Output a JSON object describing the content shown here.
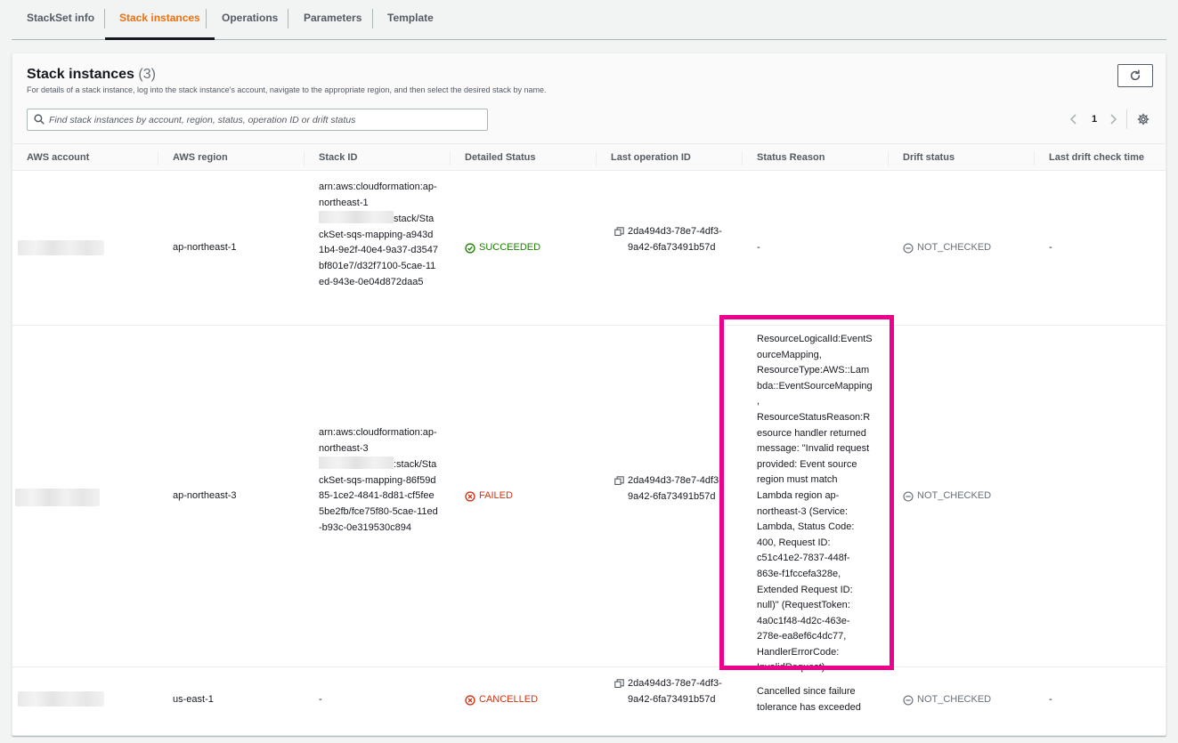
{
  "tabs": [
    {
      "label": "StackSet info",
      "active": false
    },
    {
      "label": "Stack instances",
      "active": true
    },
    {
      "label": "Operations",
      "active": false
    },
    {
      "label": "Parameters",
      "active": false
    },
    {
      "label": "Template",
      "active": false
    }
  ],
  "panel": {
    "title": "Stack instances",
    "count": "(3)",
    "description": "For details of a stack instance, log into the stack instance's account, navigate to the appropriate region, and then select the desired stack by name.",
    "search_placeholder": "Find stack instances by account, region, status, operation ID or drift status",
    "page": "1"
  },
  "columns": [
    "AWS account",
    "AWS region",
    "Stack ID",
    "Detailed Status",
    "Last operation ID",
    "Status Reason",
    "Drift status",
    "Last drift check time"
  ],
  "rows": [
    {
      "region": "ap-northeast-1",
      "stack_id_pre": "arn:aws:cloudformation:ap-northeast-1",
      "stack_id_post": "stack/StackSet-sqs-mapping-a943d1b4-9e2f-40e4-9a37-d3547bf801e7/d32f7100-5cae-11ed-943e-0e04d872daa5",
      "detailed_status": "SUCCEEDED",
      "operation_id": "2da494d3-78e7-4df3-9a42-6fa73491b57d",
      "status_reason": "-",
      "drift_status": "NOT_CHECKED",
      "last_drift": "-"
    },
    {
      "region": "ap-northeast-3",
      "stack_id_pre": "arn:aws:cloudformation:ap-northeast-3",
      "stack_id_post": ":stack/StackSet-sqs-mapping-86f59d85-1ce2-4841-8d81-cf5fee5be2fb/fce75f80-5cae-11ed-b93c-0e319530c894",
      "detailed_status": "FAILED",
      "operation_id": "2da494d3-78e7-4df3-9a42-6fa73491b57d",
      "status_reason": "ResourceLogicalId:EventSourceMapping, ResourceType:AWS::Lambda::EventSourceMapping, ResourceStatusReason:Resource handler returned message: \"Invalid request provided: Event source region must match Lambda region ap-northeast-3 (Service: Lambda, Status Code: 400, Request ID: c51c41e2-7837-448f-863e-f1fccefa328e, Extended Request ID: null)\" (RequestToken: 4a0c1f48-4d2c-463e-278e-ea8ef6c4dc77, HandlerErrorCode: InvalidRequest).",
      "drift_status": "NOT_CHECKED",
      "last_drift": ""
    },
    {
      "region": "us-east-1",
      "stack_id": "-",
      "detailed_status": "CANCELLED",
      "operation_id": "2da494d3-78e7-4df3-9a42-6fa73491b57d",
      "status_reason": "Cancelled since failure tolerance has exceeded",
      "drift_status": "NOT_CHECKED",
      "last_drift": "-"
    }
  ],
  "colors": {
    "accent": "#ec7211",
    "success": "#1d8102",
    "error": "#d13212",
    "highlight": "#ec008c"
  }
}
